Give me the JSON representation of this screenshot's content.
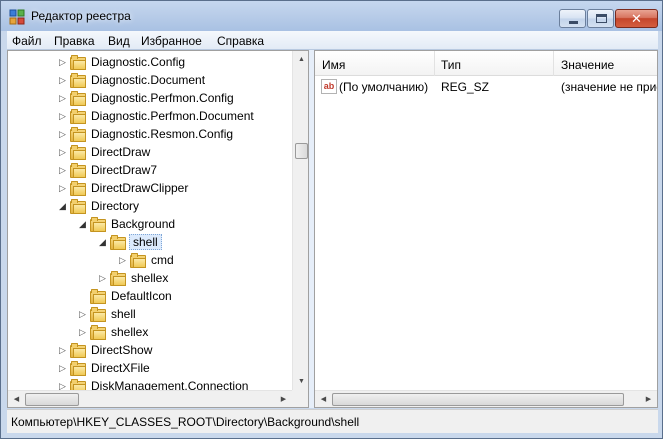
{
  "window": {
    "title": "Редактор реестра"
  },
  "title_buttons": {
    "close_glyph": "✕"
  },
  "menu": [
    {
      "label": "Файл"
    },
    {
      "label": "Правка"
    },
    {
      "label": "Вид"
    },
    {
      "label": "Избранное"
    },
    {
      "label": "Справка"
    }
  ],
  "tree": [
    {
      "label": "Diagnostic.Config",
      "toggle": "▷",
      "expanded": false
    },
    {
      "label": "Diagnostic.Document",
      "toggle": "▷",
      "expanded": false
    },
    {
      "label": "Diagnostic.Perfmon.Config",
      "toggle": "▷",
      "expanded": false
    },
    {
      "label": "Diagnostic.Perfmon.Document",
      "toggle": "▷",
      "expanded": false
    },
    {
      "label": "Diagnostic.Resmon.Config",
      "toggle": "▷",
      "expanded": false
    },
    {
      "label": "DirectDraw",
      "toggle": "▷",
      "expanded": false
    },
    {
      "label": "DirectDraw7",
      "toggle": "▷",
      "expanded": false
    },
    {
      "label": "DirectDrawClipper",
      "toggle": "▷",
      "expanded": false
    },
    {
      "label": "Directory",
      "toggle": "◢",
      "expanded": true
    },
    {
      "label": "Background",
      "toggle": "◢",
      "expanded": true
    },
    {
      "label": "shell",
      "toggle": "◢",
      "expanded": true,
      "selected": true
    },
    {
      "label": "cmd",
      "toggle": "▷",
      "expanded": false
    },
    {
      "label": "shellex",
      "toggle": "▷",
      "expanded": false
    },
    {
      "label": "DefaultIcon",
      "toggle": "",
      "expanded": false
    },
    {
      "label": "shell",
      "toggle": "▷",
      "expanded": false
    },
    {
      "label": "shellex",
      "toggle": "▷",
      "expanded": false
    },
    {
      "label": "DirectShow",
      "toggle": "▷",
      "expanded": false
    },
    {
      "label": "DirectXFile",
      "toggle": "▷",
      "expanded": false
    },
    {
      "label": "DiskManagement.Connection",
      "toggle": "▷",
      "expanded": false
    }
  ],
  "list": {
    "columns": [
      "Имя",
      "Тип",
      "Значение"
    ],
    "rows": [
      {
        "icon": "ab",
        "name": "(По умолчанию)",
        "type": "REG_SZ",
        "value": "(значение не присвоено)"
      }
    ]
  },
  "scrollbar": {
    "up": "▲",
    "down": "▼",
    "left": "◀",
    "right": "▶"
  },
  "status": {
    "path": "Компьютер\\HKEY_CLASSES_ROOT\\Directory\\Background\\shell"
  },
  "colors": {
    "titlebar": "#b9cde9",
    "selection": "#dceafc",
    "folder": "#f0c955",
    "close_button": "#c4452b"
  },
  "icons": {
    "app": "registry-editor-icon",
    "folder": "folder-icon",
    "string_value": "string-value-icon"
  }
}
